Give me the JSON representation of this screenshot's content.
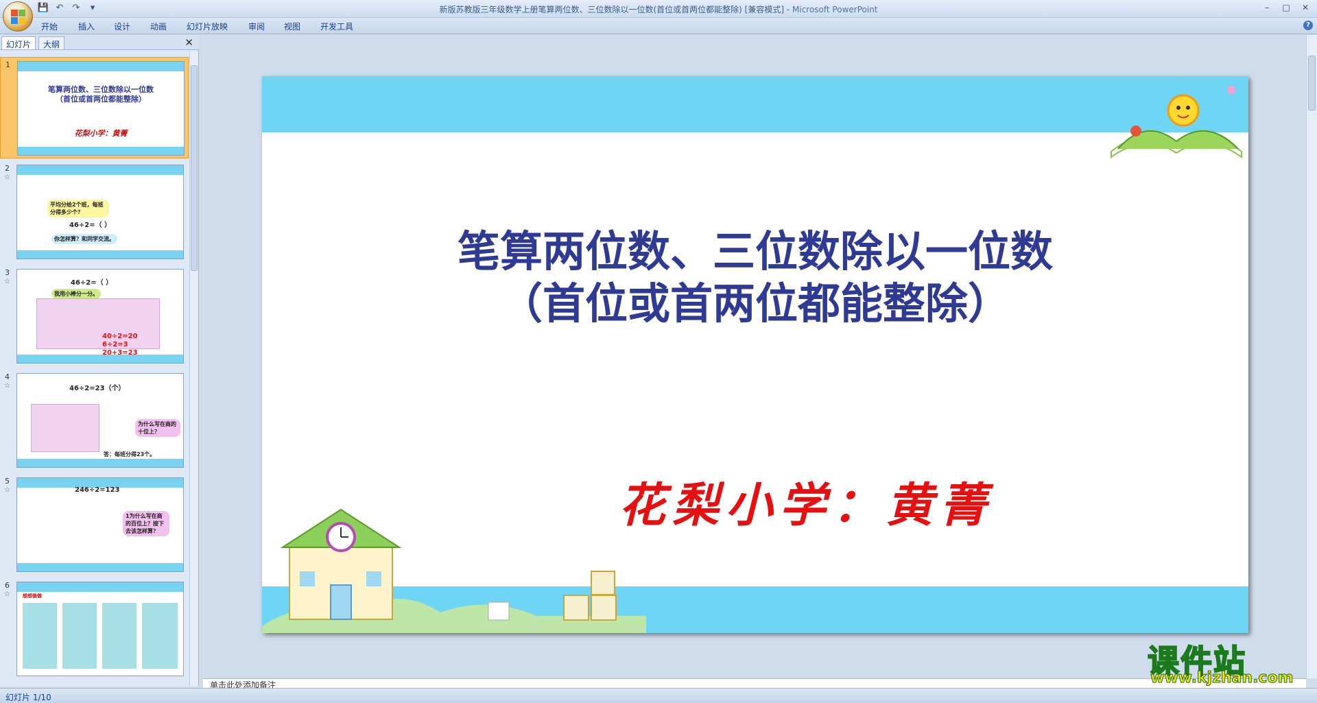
{
  "window": {
    "title": "新版苏教版三年级数学上册笔算两位数、三位数除以一位数(首位或首两位都能整除) [兼容模式]",
    "separator": " - ",
    "app_name": "Microsoft PowerPoint",
    "minimize": "–",
    "maximize": "□",
    "close": "✕"
  },
  "qat": {
    "save": "💾",
    "undo": "↶",
    "redo": "↷",
    "more": "▾"
  },
  "ribbon": {
    "tabs": [
      "开始",
      "插入",
      "设计",
      "动画",
      "幻灯片放映",
      "审阅",
      "视图",
      "开发工具"
    ],
    "help": "?"
  },
  "panel": {
    "tabs": [
      "幻灯片",
      "大纲"
    ],
    "close": "✕",
    "thumbs": [
      {
        "num": "1",
        "title": "笔算两位数、三位数除以一位数",
        "subtitle": "（首位或首两位都能整除）",
        "author": "花梨小学：黄菁"
      },
      {
        "num": "2",
        "question": "平均分给2个班，每班分得多少个？",
        "equation": "46÷2=（ ）",
        "prompt": "你怎样算？和同学交流。"
      },
      {
        "num": "3",
        "equation": "46÷2=（ ）",
        "note": "我用小棒分一分。",
        "calc1": "40÷2=20",
        "calc2": "6÷2=3",
        "calc3": "20+3=23"
      },
      {
        "num": "4",
        "equation": "46÷2=23（个）",
        "question": "为什么写在商的十位上？",
        "answer": "答：每班分得23个。"
      },
      {
        "num": "5",
        "equation": "246÷2=123",
        "question": "1为什么写在商的百位上？接下去该怎样算？"
      },
      {
        "num": "6",
        "label": "想想做做"
      }
    ]
  },
  "slide": {
    "title_line1": "笔算两位数、三位数除以一位数",
    "title_line2": "（首位或首两位都能整除）",
    "author": "花梨小学：黄菁"
  },
  "notes": {
    "text": "单击此处添加备注"
  },
  "status": {
    "text": "幻灯片 1/10"
  },
  "watermark": {
    "big": "课件站",
    "url": "www.kjzhan.com"
  },
  "colors": {
    "title_blue": "#2e3a93",
    "author_red": "#e61010",
    "band_cyan": "#6fd5f5",
    "watermark_yellow": "#f6e600"
  }
}
